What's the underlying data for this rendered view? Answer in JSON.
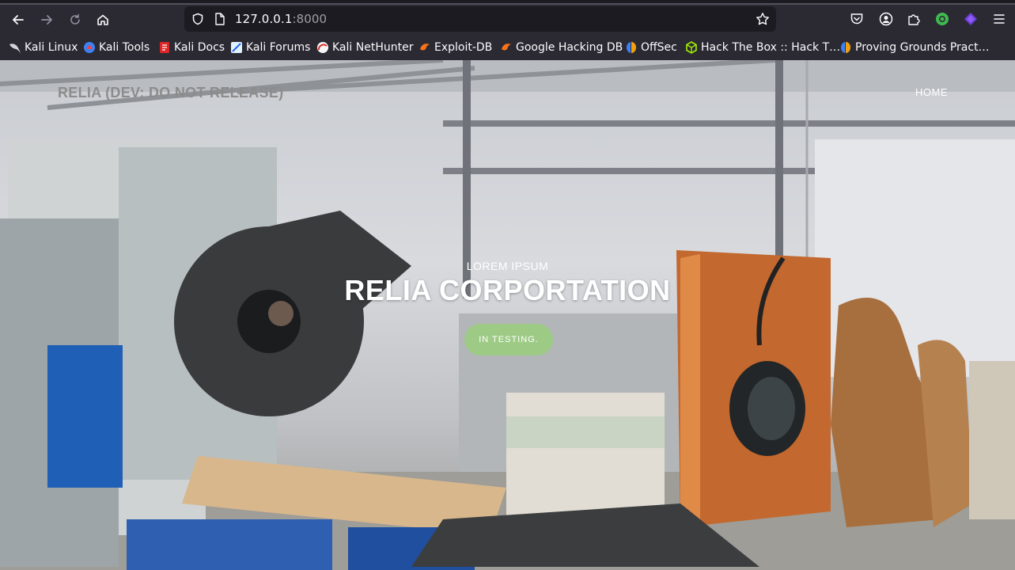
{
  "browser": {
    "url_host": "127.0.0.1",
    "url_port": ":8000",
    "colors": {
      "toolbar": "#2b2a33",
      "urlbar": "#1c1b22",
      "text": "#fbfbfe"
    }
  },
  "bookmarks": [
    {
      "label": "Kali Linux",
      "icon": "kali-dragon-icon"
    },
    {
      "label": "Kali Tools",
      "icon": "kali-tools-icon"
    },
    {
      "label": "Kali Docs",
      "icon": "kali-docs-icon"
    },
    {
      "label": "Kali Forums",
      "icon": "kali-forums-icon"
    },
    {
      "label": "Kali NetHunter",
      "icon": "nethunter-icon"
    },
    {
      "label": "Exploit-DB",
      "icon": "exploit-db-icon"
    },
    {
      "label": "Google Hacking DB",
      "icon": "ghdb-icon"
    },
    {
      "label": "OffSec",
      "icon": "offsec-icon"
    },
    {
      "label": "Hack The Box :: Hack T…",
      "icon": "htb-cube-icon"
    },
    {
      "label": "Proving Grounds Pract…",
      "icon": "proving-grounds-icon"
    }
  ],
  "site": {
    "brand": "RELIA (DEV: DO NOT RELEASE)",
    "nav_home": "HOME",
    "kicker": "LOREM IPSUM",
    "headline": "RELIA CORPORTATION",
    "cta": "IN TESTING.",
    "colors": {
      "cta": "#9dcb86",
      "brand": "#8c8c8c"
    }
  }
}
